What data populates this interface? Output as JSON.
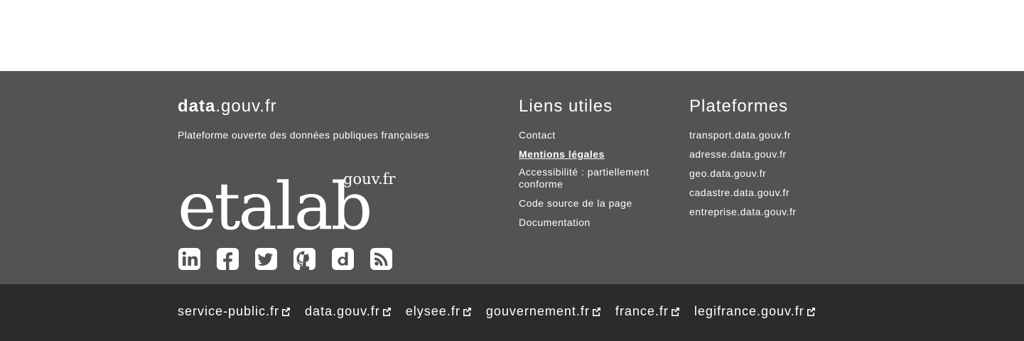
{
  "footer": {
    "brand": {
      "bold": "data",
      "rest": ".gouv.fr"
    },
    "tagline": "Plateforme ouverte des données publiques françaises",
    "logo": {
      "main": "etalab",
      "sup": "gouv.fr"
    },
    "socials": [
      {
        "icon": "linkedin-icon"
      },
      {
        "icon": "facebook-icon"
      },
      {
        "icon": "twitter-icon"
      },
      {
        "icon": "github-icon"
      },
      {
        "icon": "dailymotion-icon"
      },
      {
        "icon": "rss-icon"
      }
    ],
    "liens_utiles": {
      "title": "Liens utiles",
      "items": [
        {
          "label": "Contact"
        },
        {
          "label": "Mentions légales"
        },
        {
          "label": "Accessibilité : partiellement conforme"
        },
        {
          "label": "Code source de la page"
        },
        {
          "label": "Documentation"
        }
      ]
    },
    "plateformes": {
      "title": "Plateformes",
      "items": [
        {
          "label": "transport.data.gouv.fr"
        },
        {
          "label": "adresse.data.gouv.fr"
        },
        {
          "label": "geo.data.gouv.fr"
        },
        {
          "label": "cadastre.data.gouv.fr"
        },
        {
          "label": "entreprise.data.gouv.fr"
        }
      ]
    }
  },
  "external_links": [
    {
      "label": "service-public.fr"
    },
    {
      "label": "data.gouv.fr"
    },
    {
      "label": "elysee.fr"
    },
    {
      "label": "gouvernement.fr"
    },
    {
      "label": "france.fr"
    },
    {
      "label": "legifrance.gouv.fr"
    }
  ],
  "colors": {
    "footer_main": "#535353",
    "footer_bottom": "#2b2b2b",
    "text": "#ffffff"
  }
}
